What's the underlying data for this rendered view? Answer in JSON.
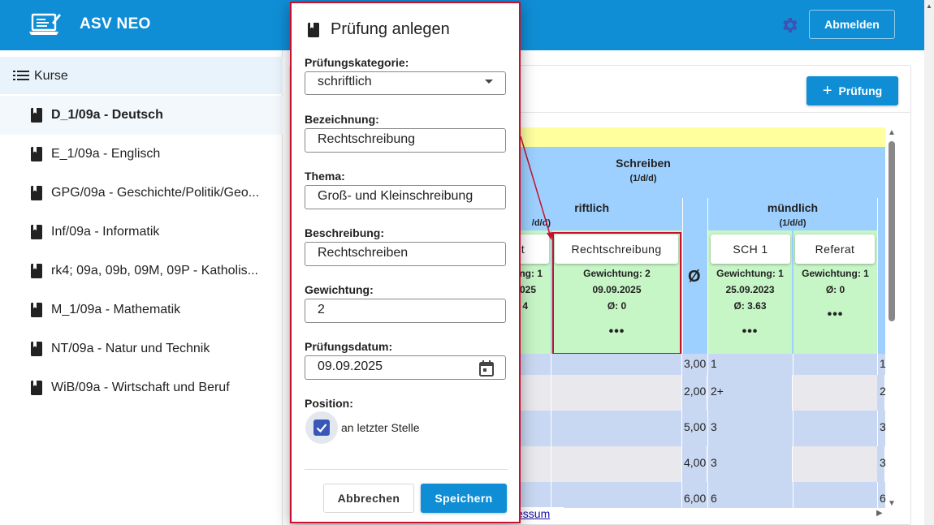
{
  "header": {
    "title": "ASV NEO",
    "logout_label": "Abmelden"
  },
  "sidebar": {
    "section_label": "Kurse",
    "items": [
      {
        "label": "D_1/09a - Deutsch",
        "active": true
      },
      {
        "label": "E_1/09a - Englisch"
      },
      {
        "label": "GPG/09a - Geschichte/Politik/Geo..."
      },
      {
        "label": "Inf/09a - Informatik"
      },
      {
        "label": "rk4; 09a, 09b, 09M, 09P - Katholis..."
      },
      {
        "label": "M_1/09a - Mathematik"
      },
      {
        "label": "NT/09a - Natur und Technik"
      },
      {
        "label": "WiB/09a - Wirtschaft und Beruf"
      }
    ]
  },
  "main": {
    "add_exam_label": "Prüfung",
    "group": {
      "title": "Schreiben",
      "weight": "(1/d/d)"
    },
    "schriftlich": {
      "title": "riftlich",
      "weight": "/d/d)"
    },
    "muendlich": {
      "title": "mündlich",
      "weight": "(1/d/d)"
    },
    "exams": [
      {
        "chip": "t",
        "weight": "ng: 1",
        "date": "025",
        "avg": "4"
      },
      {
        "chip": "Rechtschreibung",
        "weight": "Gewichtung: 2",
        "date": "09.09.2025",
        "avg": "Ø:  0",
        "dots": "•••"
      },
      {
        "chip": "SCH 1",
        "weight": "Gewichtung: 1",
        "date": "25.09.2023",
        "avg": "Ø:  3.63",
        "dots": "•••"
      },
      {
        "chip": "Referat",
        "weight": "Gewichtung: 1",
        "date": "Ø:  0",
        "dots": "•••"
      }
    ],
    "avg_symbol": "Ø",
    "rows": [
      {
        "avg": "3,00",
        "grade": "1",
        "next": "1"
      },
      {
        "avg": "2,00",
        "grade": "2+",
        "next": "2"
      },
      {
        "avg": "5,00",
        "grade": "3",
        "next": "3"
      },
      {
        "avg": "4,00",
        "grade": "3",
        "next": "3"
      },
      {
        "avg": "6,00",
        "grade": "6",
        "next": "6"
      }
    ],
    "impressum": "essum"
  },
  "dialog": {
    "title": "Prüfung anlegen",
    "category_label": "Prüfungskategorie:",
    "category_value": "schriftlich",
    "name_label": "Bezeichnung:",
    "name_value": "Rechtschreibung",
    "topic_label": "Thema:",
    "topic_value": "Groß- und Kleinschreibung",
    "description_label": "Beschreibung:",
    "description_value": "Rechtschreiben",
    "weight_label": "Gewichtung:",
    "weight_value": "2",
    "date_label": "Prüfungsdatum:",
    "date_value": "09.09.2025",
    "position_label": "Position:",
    "position_option": "an letzter Stelle",
    "cancel_label": "Abbrechen",
    "save_label": "Speichern"
  },
  "colors": {
    "brand": "#0f8ed6",
    "highlight": "#c8102e",
    "group_header": "#9dd0ff",
    "exam_cell": "#c6f5c6",
    "checkbox": "#3957b8"
  }
}
